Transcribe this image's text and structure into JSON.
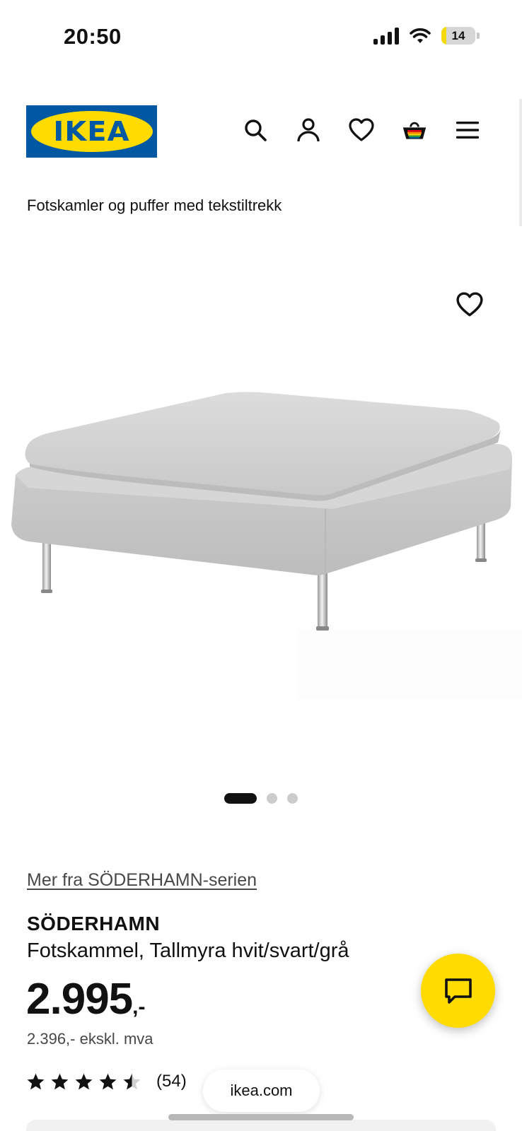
{
  "status_bar": {
    "time": "20:50",
    "battery_level": "14",
    "icons": [
      "signal-icon",
      "wifi-icon",
      "battery-icon"
    ]
  },
  "header": {
    "logo_text": "IKEA",
    "icons": [
      "search-icon",
      "account-icon",
      "heart-icon",
      "cart-icon",
      "menu-icon"
    ]
  },
  "breadcrumb": "Fotskamler og puffer med tekstiltrekk",
  "gallery": {
    "total_images": 3,
    "active_index": 0
  },
  "product": {
    "series_link": "Mer fra SÖDERHAMN-serien",
    "name": "SÖDERHAMN",
    "description": "Fotskammel, Tallmyra hvit/svart/grå",
    "price": "2.995",
    "price_suffix": ",-",
    "price_ex_vat": "2.396,- ekskl. mva",
    "rating_value": 4.5,
    "rating_count": "(54)"
  },
  "browser": {
    "url": "ikea.com"
  },
  "colors": {
    "ikea_blue": "#0058a3",
    "ikea_yellow": "#ffdb00"
  }
}
